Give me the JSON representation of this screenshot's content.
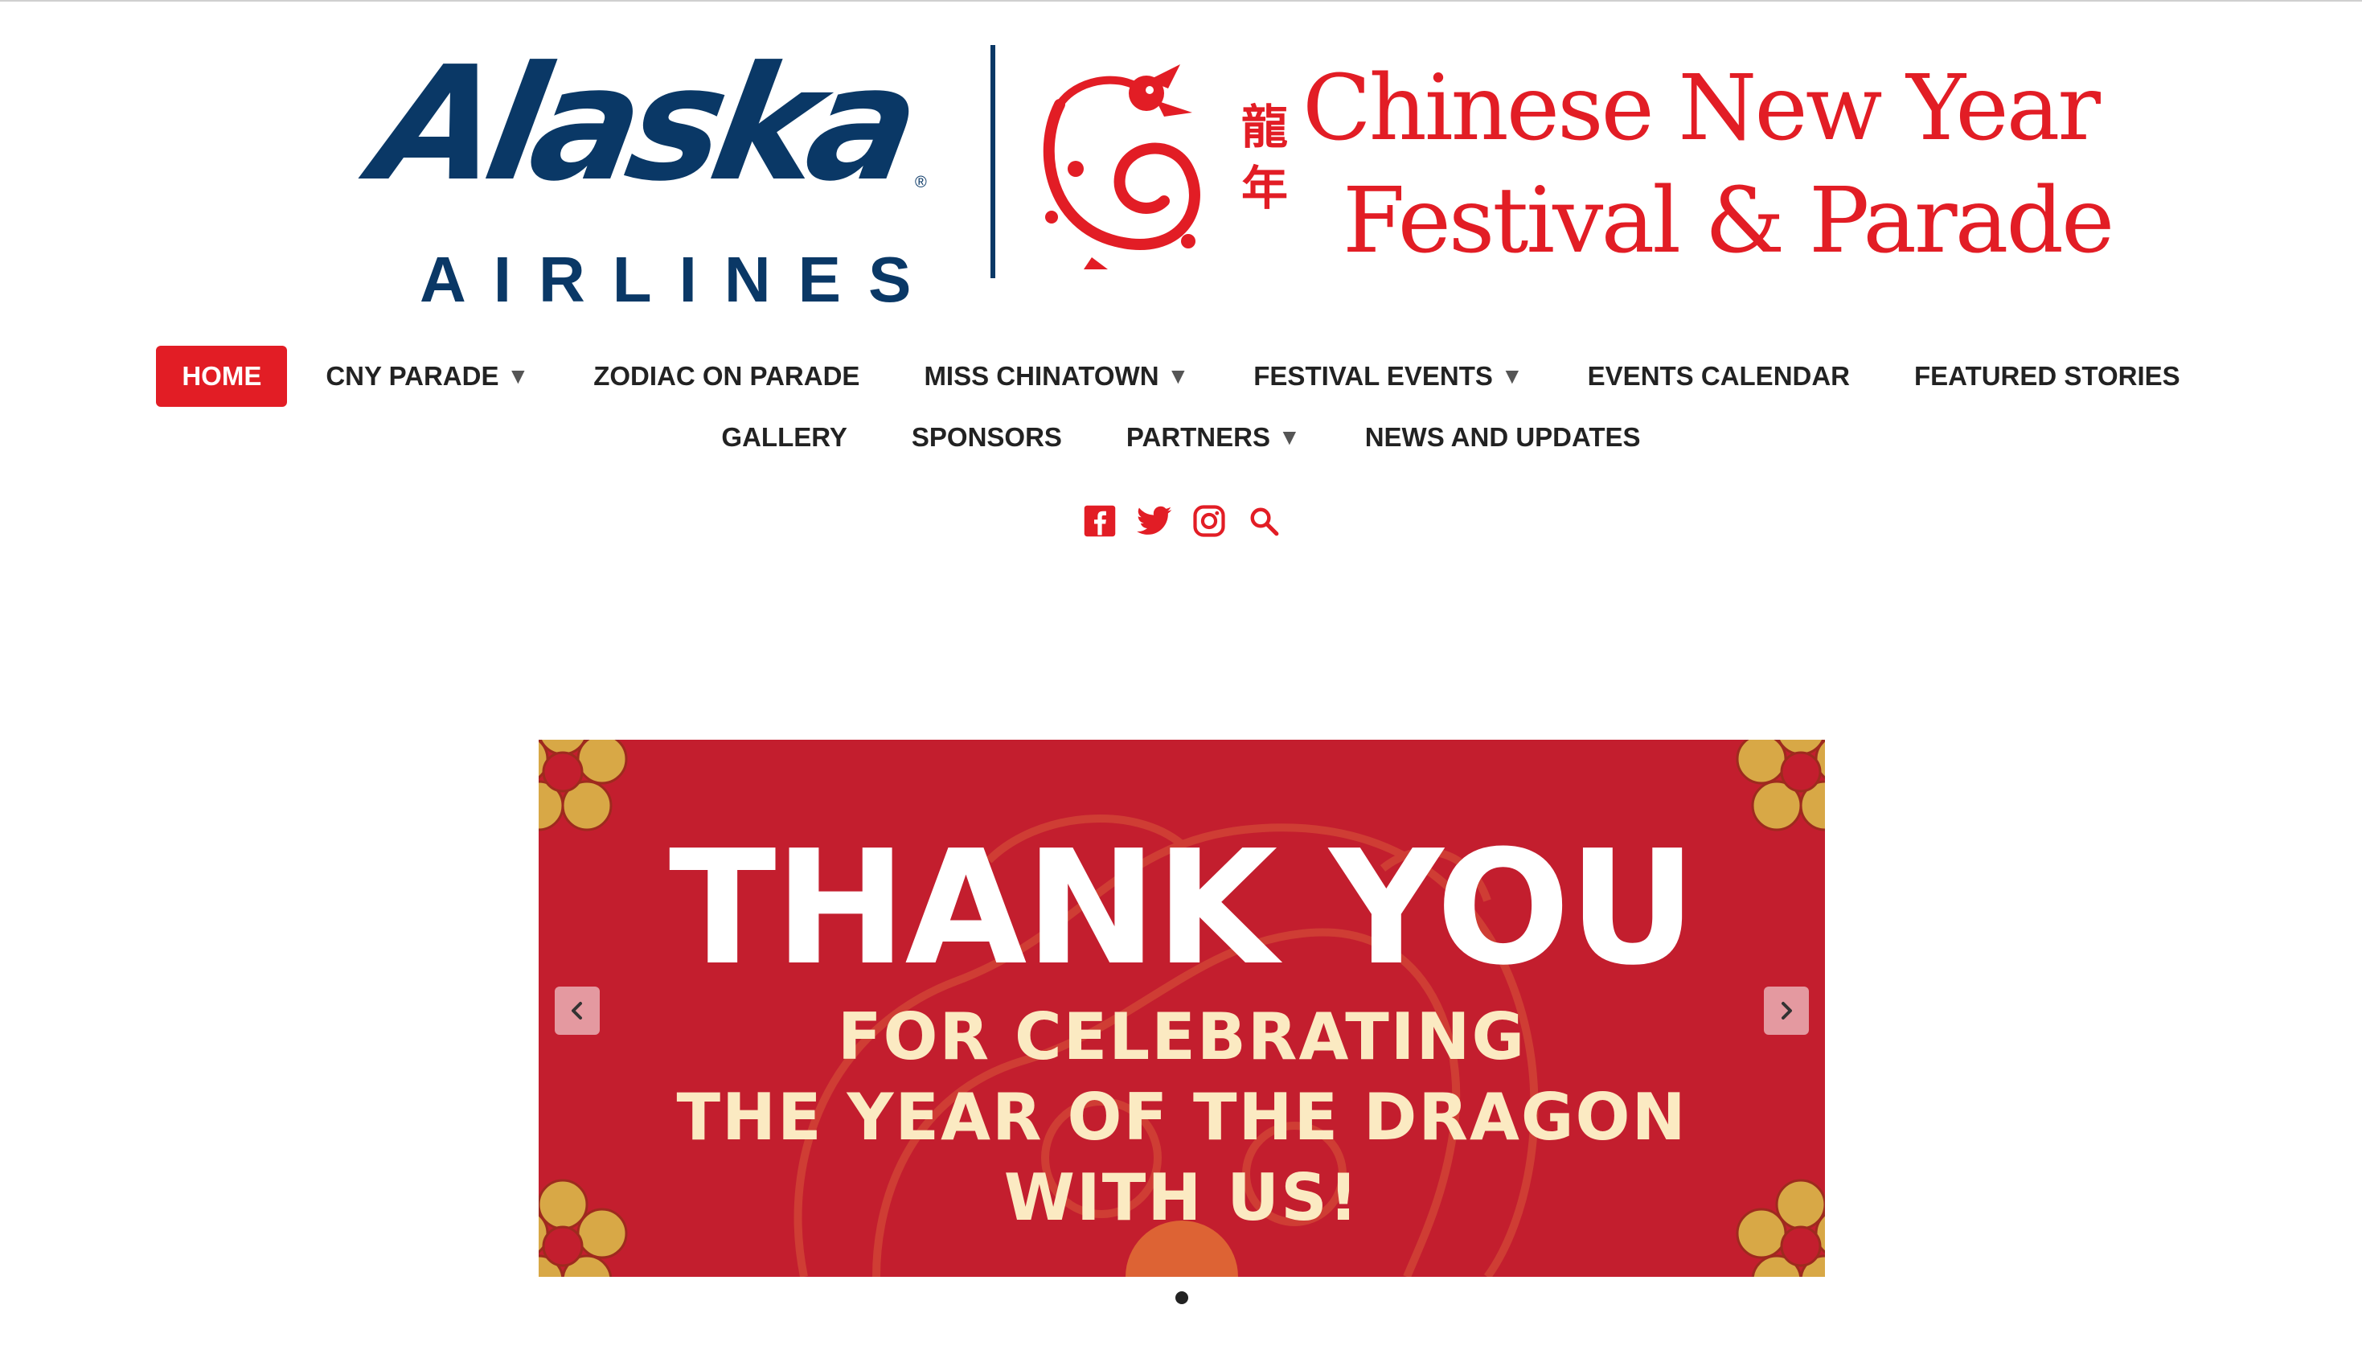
{
  "header": {
    "airline_logo": {
      "word": "Alaska",
      "subword": "AIRLINES",
      "registered": "®"
    },
    "event_logo": {
      "chinese_chars": [
        "龍",
        "年"
      ],
      "line1": "Chinese New Year",
      "line2": "Festival & Parade"
    }
  },
  "nav": {
    "row1": [
      {
        "label": "HOME",
        "active": true,
        "dropdown": false
      },
      {
        "label": "CNY PARADE",
        "active": false,
        "dropdown": true
      },
      {
        "label": "ZODIAC ON PARADE",
        "active": false,
        "dropdown": false
      },
      {
        "label": "MISS CHINATOWN",
        "active": false,
        "dropdown": true
      },
      {
        "label": "FESTIVAL EVENTS",
        "active": false,
        "dropdown": true
      },
      {
        "label": "EVENTS CALENDAR",
        "active": false,
        "dropdown": false
      },
      {
        "label": "FEATURED STORIES",
        "active": false,
        "dropdown": false
      }
    ],
    "row2": [
      {
        "label": "GALLERY",
        "active": false,
        "dropdown": false
      },
      {
        "label": "SPONSORS",
        "active": false,
        "dropdown": false
      },
      {
        "label": "PARTNERS",
        "active": false,
        "dropdown": true
      },
      {
        "label": "NEWS AND UPDATES",
        "active": false,
        "dropdown": false
      }
    ],
    "caret": "▼"
  },
  "social": {
    "icons": [
      "facebook-icon",
      "twitter-icon",
      "instagram-icon",
      "search-icon"
    ],
    "color": "#e21d25"
  },
  "slider": {
    "slide": {
      "title": "THANK YOU",
      "lines": [
        "FOR CELEBRATING",
        "THE YEAR OF THE DRAGON",
        "WITH US!"
      ]
    },
    "prev_icon": "chevron-left-icon",
    "next_icon": "chevron-right-icon",
    "dot_count": 1,
    "active_dot": 1
  },
  "colors": {
    "brand_red": "#e21d25",
    "alaska_navy": "#0a3866",
    "slide_red": "#c31e2e",
    "gold": "#d8a846",
    "cream": "#fbeac2"
  }
}
